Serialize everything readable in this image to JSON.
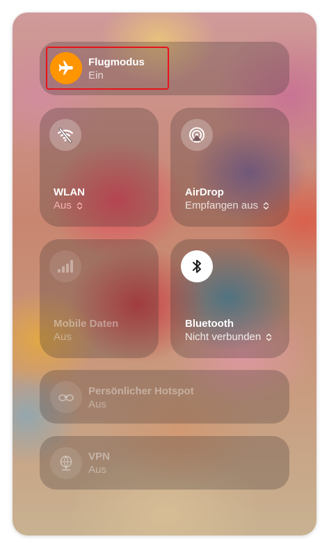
{
  "airplane": {
    "title": "Flugmodus",
    "status": "Ein",
    "icon": "airplane-icon",
    "state_color": "#FF9500"
  },
  "wlan": {
    "title": "WLAN",
    "status": "Aus",
    "icon": "wifi-off-icon",
    "status_color": "#F7B3B3"
  },
  "airdrop": {
    "title": "AirDrop",
    "status": "Empfangen aus",
    "icon": "airdrop-icon"
  },
  "mobile": {
    "title": "Mobile Daten",
    "status": "Aus",
    "icon": "cellular-bars-icon",
    "disabled": true
  },
  "bluetooth": {
    "title": "Bluetooth",
    "status": "Nicht verbunden",
    "icon": "bluetooth-icon",
    "state_color": "#FFFFFF"
  },
  "hotspot": {
    "title": "Persönlicher Hotspot",
    "status": "Aus",
    "icon": "hotspot-icon",
    "disabled": true
  },
  "vpn": {
    "title": "VPN",
    "status": "Aus",
    "icon": "vpn-globe-icon",
    "disabled": true
  },
  "highlight_color": "#E8121B"
}
